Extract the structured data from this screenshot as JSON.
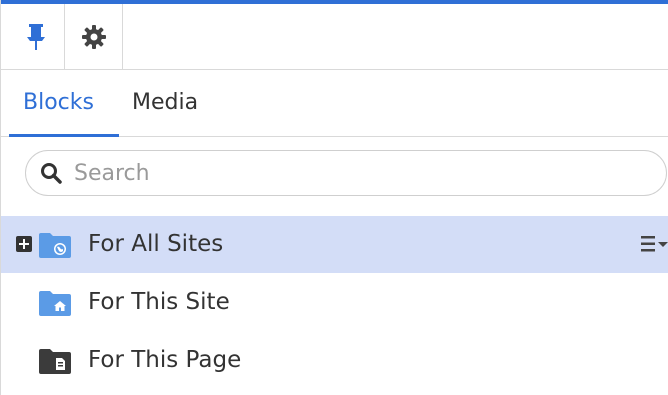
{
  "colors": {
    "accent": "#2f6fd6",
    "selected_row": "#d3ddf7",
    "folder_blue": "#5b9be6",
    "folder_dark": "#3b3b3b"
  },
  "toolbar": {
    "pin_icon": "pin-icon",
    "settings_icon": "gear-icon"
  },
  "tabs": [
    {
      "label": "Blocks",
      "active": true
    },
    {
      "label": "Media",
      "active": false
    }
  ],
  "search": {
    "placeholder": "Search",
    "value": ""
  },
  "tree": {
    "items": [
      {
        "label": "For All Sites",
        "icon": "globe-folder-icon",
        "expandable": true,
        "selected": true
      },
      {
        "label": "For This Site",
        "icon": "home-folder-icon",
        "expandable": false,
        "selected": false
      },
      {
        "label": "For This Page",
        "icon": "page-folder-icon",
        "expandable": false,
        "selected": false
      }
    ]
  }
}
